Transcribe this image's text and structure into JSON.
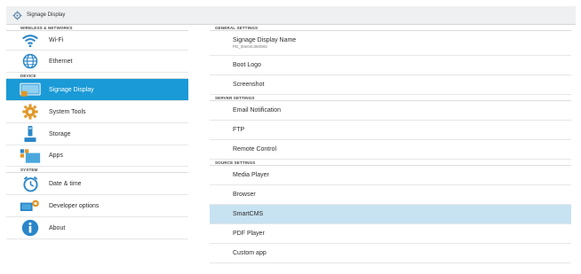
{
  "window": {
    "title": "Signage Display",
    "icon": "gear-icon"
  },
  "left": {
    "sections": [
      {
        "label": "WIRELESS & NETWORKS",
        "items": [
          {
            "label": "Wi-Fi",
            "icon": "wifi-icon"
          },
          {
            "label": "Ethernet",
            "icon": "globe-icon"
          }
        ]
      },
      {
        "label": "DEVICE",
        "items": [
          {
            "label": "Signage Display",
            "icon": "display-icon",
            "selected": true
          },
          {
            "label": "System Tools",
            "icon": "gear-icon"
          },
          {
            "label": "Storage",
            "icon": "storage-icon"
          },
          {
            "label": "Apps",
            "icon": "apps-icon"
          }
        ]
      },
      {
        "label": "SYSTEM",
        "items": [
          {
            "label": "Date & time",
            "icon": "clock-icon"
          },
          {
            "label": "Developer options",
            "icon": "developer-icon"
          },
          {
            "label": "About",
            "icon": "info-icon"
          }
        ]
      }
    ]
  },
  "right": {
    "sections": [
      {
        "label": "GENERAL SETTINGS",
        "items": [
          {
            "label": "Signage Display Name",
            "sub": "PD_00e04c36008S"
          },
          {
            "label": "Boot Logo"
          },
          {
            "label": "Screenshot"
          }
        ]
      },
      {
        "label": "SERVER SETTINGS",
        "items": [
          {
            "label": "Email Notification"
          },
          {
            "label": "FTP"
          },
          {
            "label": "Remote Control"
          }
        ]
      },
      {
        "label": "SOURCE SETTINGS",
        "items": [
          {
            "label": "Media Player"
          },
          {
            "label": "Browser"
          },
          {
            "label": "SmartCMS",
            "highlight": true
          },
          {
            "label": "PDF Player"
          },
          {
            "label": "Custom app"
          }
        ]
      }
    ]
  },
  "colors": {
    "selected": "#1a9ad6",
    "highlight": "#c7e2f1",
    "icon_blue": "#2a86c9",
    "icon_orange": "#e0982a"
  }
}
